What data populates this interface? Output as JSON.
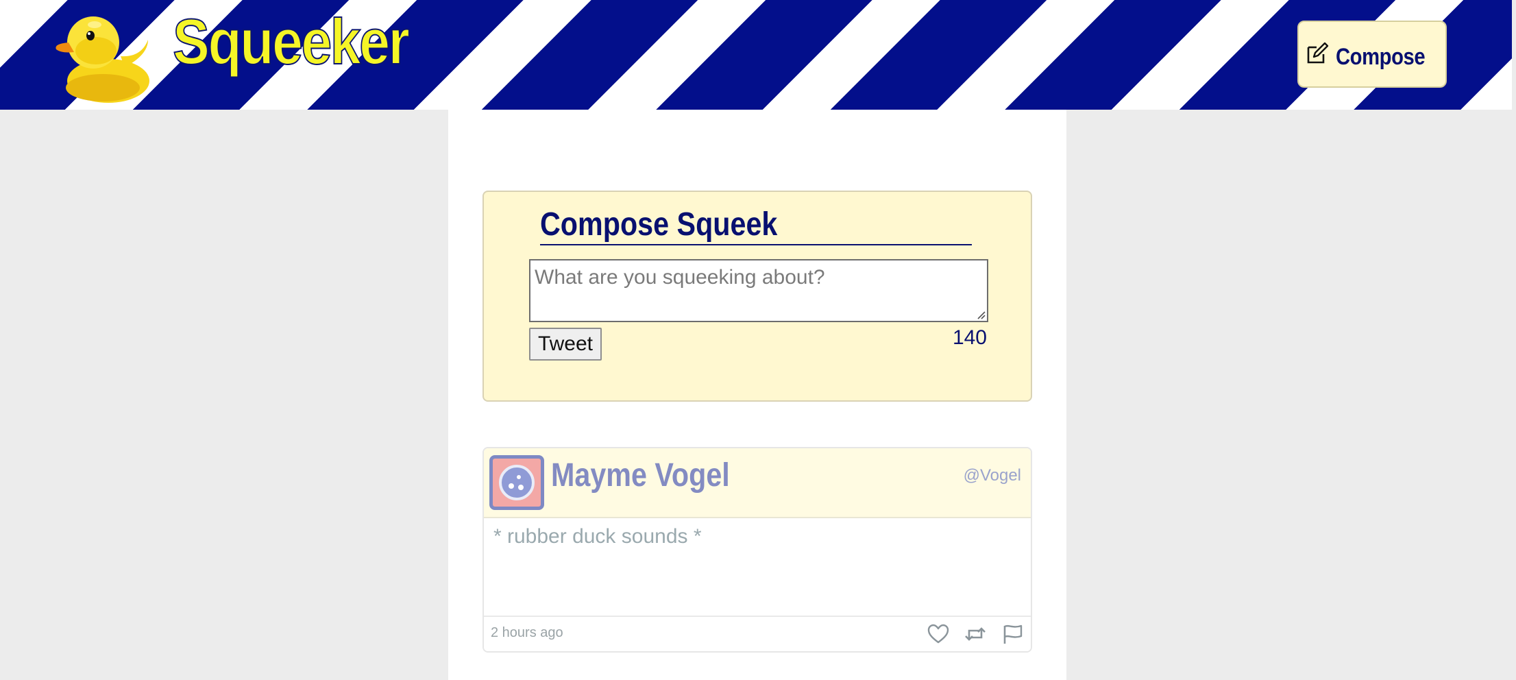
{
  "header": {
    "logo_icon": "rubber-duck-icon",
    "brand": "Squeeker",
    "compose_icon": "edit-icon",
    "compose_label": "Compose",
    "stripe_colors": [
      "#030f8b",
      "#ffffff"
    ],
    "brand_color": "#f5f527"
  },
  "composer": {
    "title": "Compose Squeek",
    "placeholder": "What are you squeeking about?",
    "submit_label": "Tweet",
    "char_count": "140"
  },
  "feed": {
    "squeeks": [
      {
        "author_name": "Mayme Vogel",
        "handle": "@Vogel",
        "avatar_icon": "avatar-icon",
        "text": "* rubber duck sounds *",
        "time": "2 hours ago",
        "actions": [
          "heart-icon",
          "retweet-icon",
          "flag-icon"
        ]
      }
    ]
  },
  "colors": {
    "accent": "#081070",
    "panel": "#fff8d0",
    "background": "#ececec"
  }
}
